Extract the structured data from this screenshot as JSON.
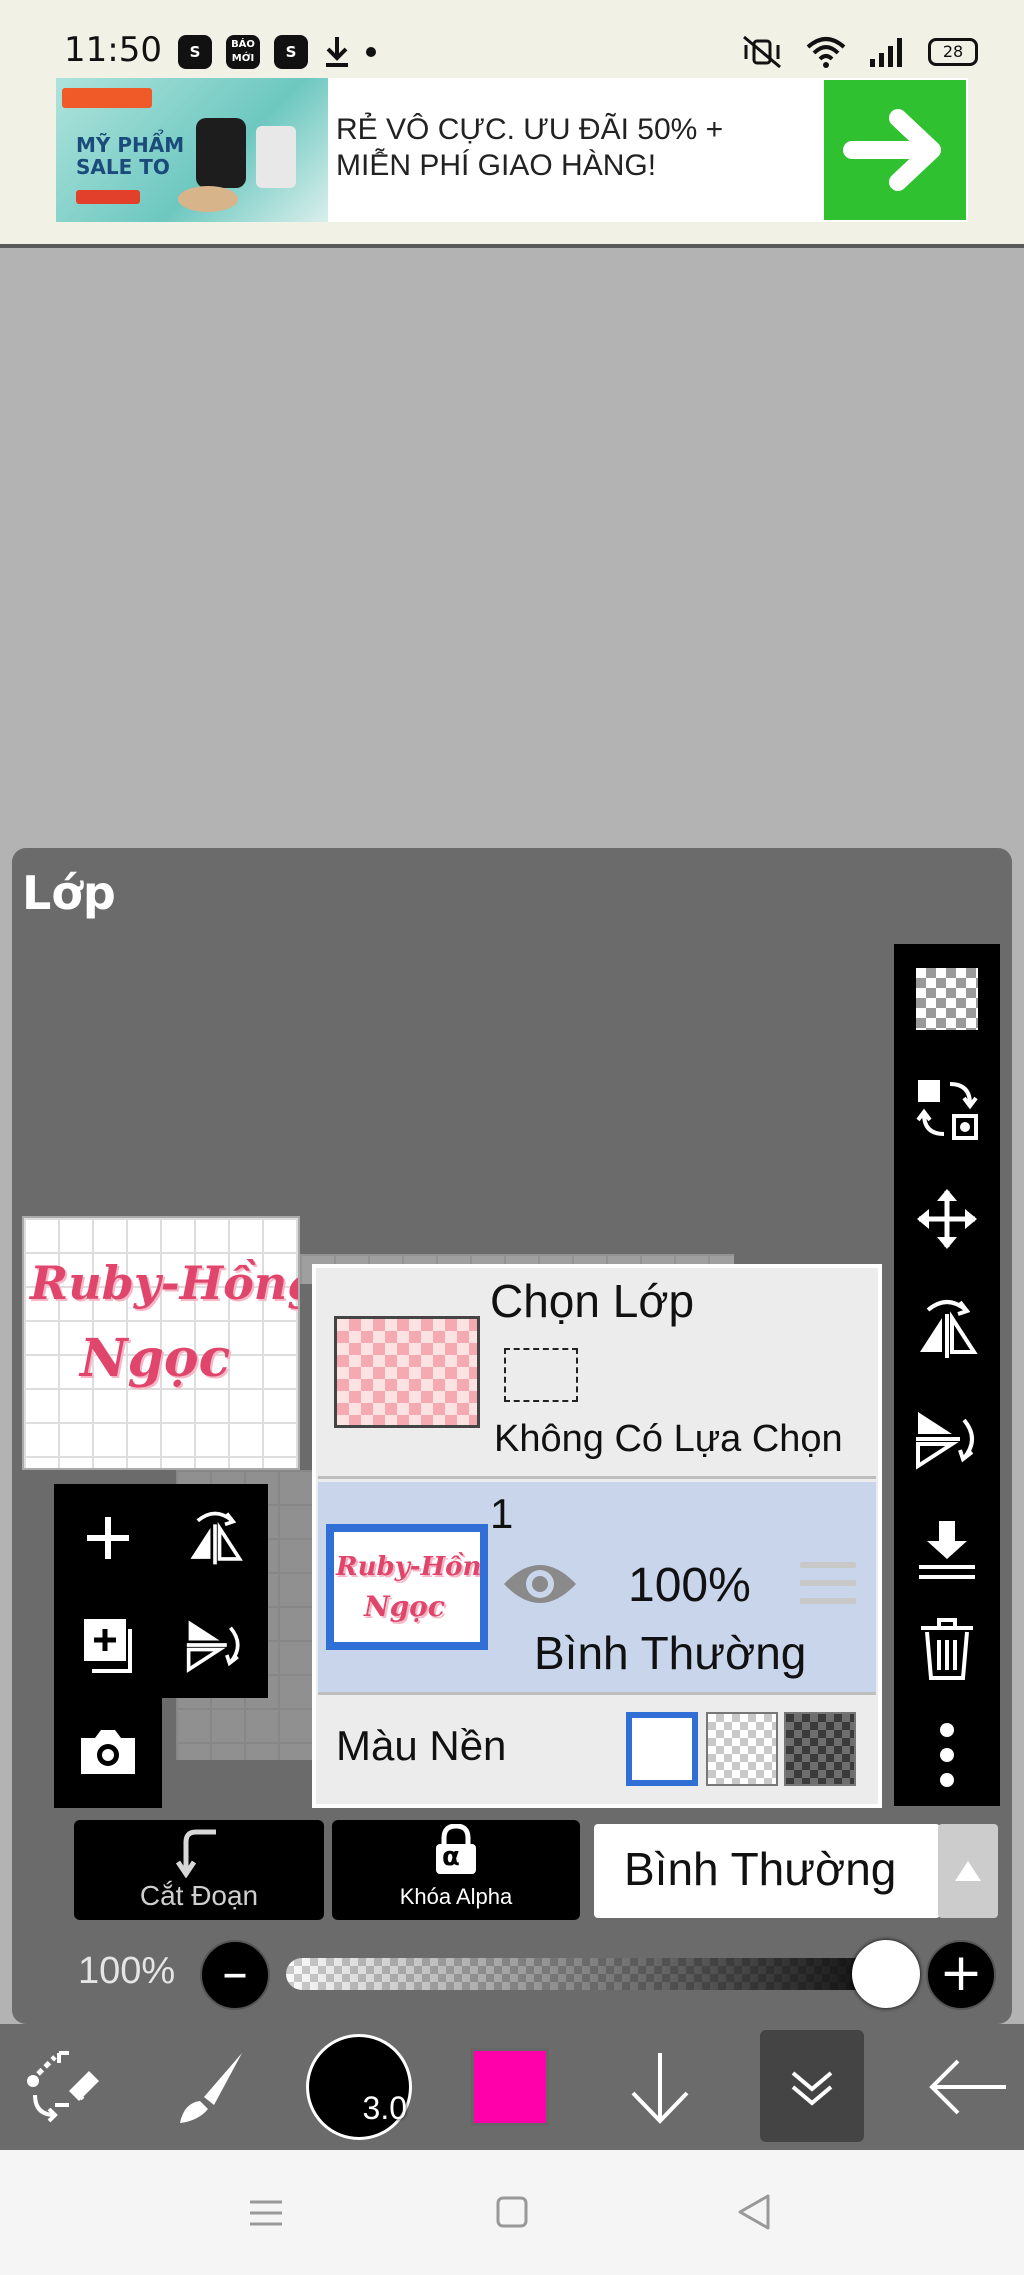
{
  "status_bar": {
    "time": "11:50",
    "notif_icons": [
      "S",
      "BÁO MỚI",
      "S"
    ],
    "battery": "28"
  },
  "ad": {
    "image_title": "MỸ PHẨM SALE TO",
    "text": "RẺ VÔ CỰC. ƯU ĐÃI 50% + MIỄN PHÍ GIAO HÀNG!",
    "button_icon": "arrow-right-icon"
  },
  "layer_panel": {
    "title": "Lớp",
    "selection_layer": {
      "title": "Chọn Lớp",
      "status": "Không Có Lựa Chọn"
    },
    "layer": {
      "number": "1",
      "opacity": "100%",
      "blend_mode": "Bình Thường"
    },
    "background": {
      "label": "Màu Nền",
      "options": [
        "white",
        "light-checker",
        "dark-checker"
      ],
      "selected": "white"
    },
    "preview_text": [
      "Ruby-Hồng",
      "Ngọc"
    ]
  },
  "bottom_controls": {
    "clipping_label": "Cắt Đoạn",
    "alpha_lock_label": "Khóa Alpha",
    "alpha_glyph": "α",
    "blend_mode": "Bình Thường",
    "opacity_label": "100%",
    "opacity_value": 1.0
  },
  "toolbar": {
    "brush_size": "3.0",
    "current_color": "#ff00aa"
  },
  "colors": {
    "panel": "#6b6b6b",
    "selection_blue": "#2f6fd6",
    "layer_row": "#c8d5ea",
    "ad_green": "#2fc12f"
  }
}
